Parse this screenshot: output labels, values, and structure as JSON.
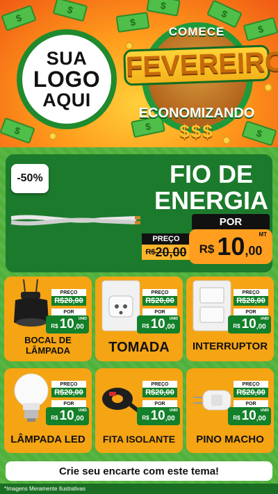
{
  "header": {
    "logo_line1": "SUA",
    "logo_line2": "LOGO",
    "logo_line3": "AQUI",
    "campaign_top": "COMECE",
    "campaign_month": "FEVEREIRO",
    "campaign_bottom": "ECONOMIZANDO",
    "campaign_symbols": "$$$"
  },
  "hero": {
    "discount": "-50%",
    "title_line1": "FIO DE",
    "title_line2": "ENERGIA",
    "por_label": "POR",
    "preco_label": "PREÇO",
    "old_currency": "R$",
    "old_price": "20,00",
    "new_currency": "R$",
    "new_int": "10",
    "new_dec": ",00",
    "unit": "MT"
  },
  "products": [
    {
      "name": "BOCAL DE LÂMPADA",
      "preco_label": "PREÇO",
      "old_price": "R$20,00",
      "por_label": "POR",
      "currency": "R$",
      "int": "10",
      "dec": ",00",
      "unit": "UNID"
    },
    {
      "name": "TOMADA",
      "preco_label": "PREÇO",
      "old_price": "R$20,00",
      "por_label": "POR",
      "currency": "R$",
      "int": "10",
      "dec": ",00",
      "unit": "UNID"
    },
    {
      "name": "INTERRUPTOR",
      "preco_label": "PREÇO",
      "old_price": "R$20,00",
      "por_label": "POR",
      "currency": "R$",
      "int": "10",
      "dec": ",00",
      "unit": "UNID"
    },
    {
      "name": "LÂMPADA LED",
      "preco_label": "PREÇO",
      "old_price": "R$20,00",
      "por_label": "POR",
      "currency": "R$",
      "int": "10",
      "dec": ",00",
      "unit": "UNID"
    },
    {
      "name": "FITA ISOLANTE",
      "preco_label": "PREÇO",
      "old_price": "R$20,00",
      "por_label": "POR",
      "currency": "R$",
      "int": "10",
      "dec": ",00",
      "unit": "UNID"
    },
    {
      "name": "PINO MACHO",
      "preco_label": "PREÇO",
      "old_price": "R$20,00",
      "por_label": "POR",
      "currency": "R$",
      "int": "10",
      "dec": ",00",
      "unit": "UNID"
    }
  ],
  "footer": {
    "cta": "Crie seu encarte com este tema!",
    "note": "*Imagens Meramente Ilustrativas"
  },
  "colors": {
    "green_dark": "#1c7a2c",
    "green_bg": "#4fb03a",
    "orange": "#f5a413",
    "header_orange": "#ff9d1c"
  }
}
